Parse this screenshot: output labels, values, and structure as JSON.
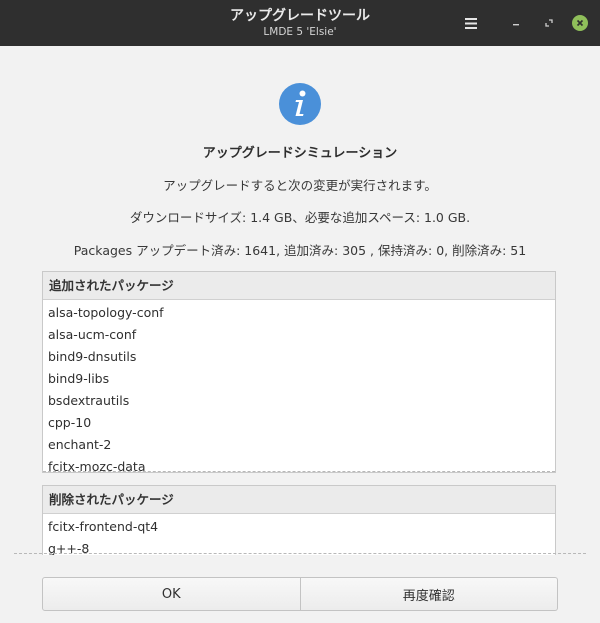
{
  "window": {
    "title": "アップグレードツール",
    "subtitle": "LMDE 5 'Elsie'"
  },
  "icons": {
    "info": "info-icon",
    "menu": "hamburger-menu-icon",
    "minimize": "minimize-icon",
    "maximize": "maximize-icon",
    "close": "close-icon"
  },
  "colors": {
    "titlebar": "#2f2f2f",
    "info_icon": "#4a90d9",
    "close_button": "#8fbf5a"
  },
  "dialog": {
    "heading": "アップグレードシミュレーション",
    "line1": "アップグレードすると次の変更が実行されます。",
    "line2": "ダウンロードサイズ: 1.4 GB、必要な追加スペース: 1.0 GB.",
    "line3": "Packages アップデート済み: 1641, 追加済み: 305 , 保持済み: 0, 削除済み: 51"
  },
  "added": {
    "header": "追加されたパッケージ",
    "items": [
      "alsa-topology-conf",
      "alsa-ucm-conf",
      "bind9-dnsutils",
      "bind9-libs",
      "bsdextrautils",
      "cpp-10",
      "enchant-2",
      "fcitx-mozc-data"
    ]
  },
  "removed": {
    "header": "削除されたパッケージ",
    "items": [
      "fcitx-frontend-qt4",
      "g++-8"
    ]
  },
  "buttons": {
    "ok": "OK",
    "recheck": "再度確認"
  }
}
